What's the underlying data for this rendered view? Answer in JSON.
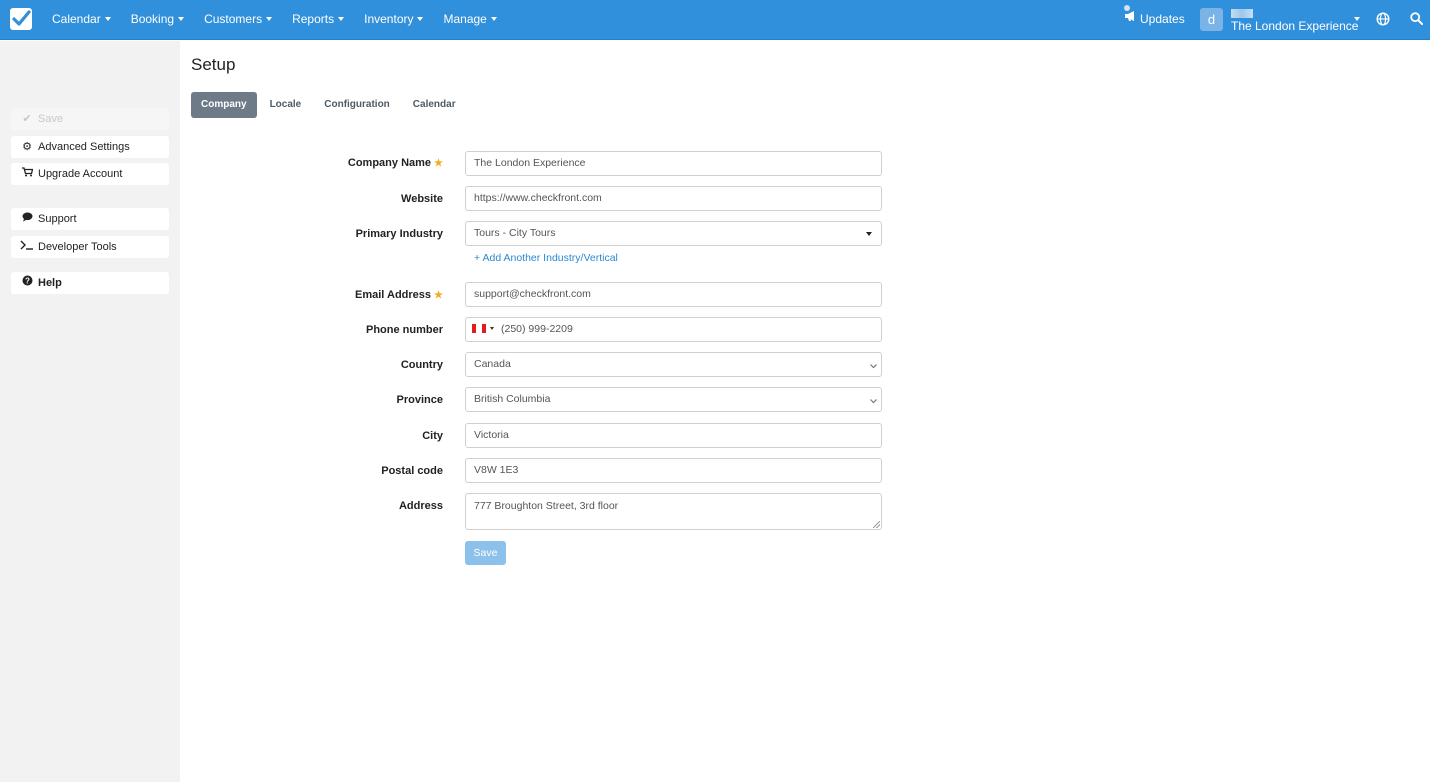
{
  "nav": {
    "items": [
      "Calendar",
      "Booking",
      "Customers",
      "Reports",
      "Inventory",
      "Manage"
    ],
    "updates_label": "Updates",
    "avatar_letter": "d",
    "account_name": "The London Experience"
  },
  "sidebar": {
    "save_label": "Save",
    "advanced_settings": "Advanced Settings",
    "upgrade_account": "Upgrade Account",
    "support": "Support",
    "developer_tools": "Developer Tools",
    "help": "Help"
  },
  "page": {
    "title": "Setup",
    "tabs": [
      "Company",
      "Locale",
      "Configuration",
      "Calendar"
    ],
    "active_tab": "Company"
  },
  "form": {
    "company_name": {
      "label": "Company Name",
      "value": "The London Experience"
    },
    "website": {
      "label": "Website",
      "value": "https://www.checkfront.com"
    },
    "primary_industry": {
      "label": "Primary Industry",
      "value": "Tours - City Tours"
    },
    "add_industry_link": "+ Add Another Industry/Vertical",
    "email": {
      "label": "Email Address",
      "value": "support@checkfront.com"
    },
    "phone": {
      "label": "Phone number",
      "value": "(250) 999-2209"
    },
    "country": {
      "label": "Country",
      "value": "Canada"
    },
    "province": {
      "label": "Province",
      "value": "British Columbia"
    },
    "city": {
      "label": "City",
      "value": "Victoria"
    },
    "postal_code": {
      "label": "Postal code",
      "value": "V8W 1E3"
    },
    "address": {
      "label": "Address",
      "value": "777 Broughton Street, 3rd floor"
    },
    "save_label": "Save"
  },
  "colors": {
    "nav_bg": "#3190db",
    "active_tab": "#6e7a87",
    "link": "#2b89cf",
    "required_star": "#f0ad1e",
    "save_button": "#8cc1ec"
  }
}
